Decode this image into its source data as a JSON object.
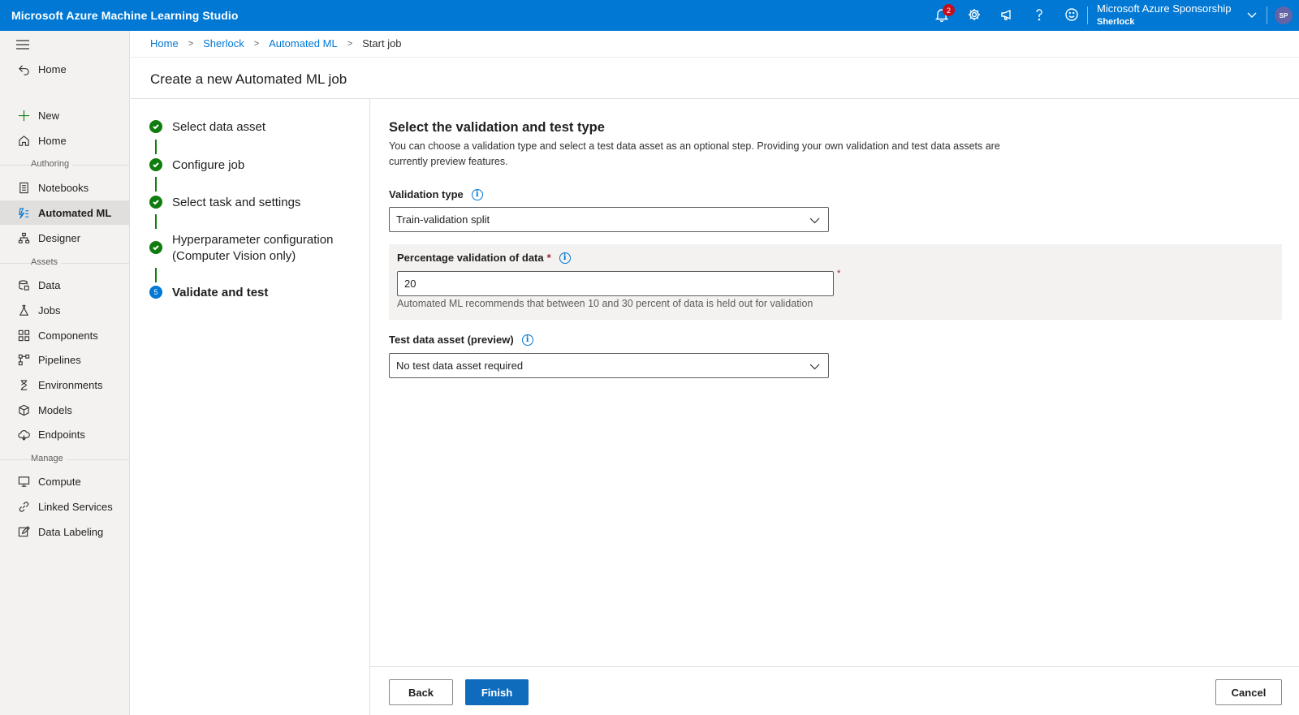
{
  "app": {
    "title": "Microsoft Azure Machine Learning Studio"
  },
  "topbar": {
    "notification_count": "2",
    "subscription": "Microsoft Azure Sponsorship",
    "workspace": "Sherlock",
    "avatar_initials": "SP",
    "icons": [
      "bell-icon",
      "gear-icon",
      "megaphone-icon",
      "help-icon",
      "smiley-icon",
      "chevron-down-icon"
    ]
  },
  "sidebar": {
    "top_item": {
      "label": "Home",
      "icon": "back-arrow-icon"
    },
    "sections": {
      "authoring": "Authoring",
      "assets": "Assets",
      "manage": "Manage"
    },
    "items": [
      {
        "label": "New",
        "icon": "plus-icon"
      },
      {
        "label": "Home",
        "icon": "home-icon"
      },
      {
        "label": "Notebooks",
        "icon": "notebook-icon"
      },
      {
        "label": "Automated ML",
        "icon": "automl-icon",
        "active": true
      },
      {
        "label": "Designer",
        "icon": "designer-icon"
      },
      {
        "label": "Data",
        "icon": "data-icon"
      },
      {
        "label": "Jobs",
        "icon": "flask-icon"
      },
      {
        "label": "Components",
        "icon": "components-icon"
      },
      {
        "label": "Pipelines",
        "icon": "pipelines-icon"
      },
      {
        "label": "Environments",
        "icon": "environments-icon"
      },
      {
        "label": "Models",
        "icon": "cube-icon"
      },
      {
        "label": "Endpoints",
        "icon": "cloud-icon"
      },
      {
        "label": "Compute",
        "icon": "monitor-icon"
      },
      {
        "label": "Linked Services",
        "icon": "link-icon"
      },
      {
        "label": "Data Labeling",
        "icon": "edit-icon"
      }
    ]
  },
  "breadcrumb": [
    "Home",
    "Sherlock",
    "Automated ML",
    "Start job"
  ],
  "page": {
    "title": "Create a new Automated ML job"
  },
  "steps": [
    {
      "label": "Select data asset",
      "status": "done"
    },
    {
      "label": "Configure job",
      "status": "done"
    },
    {
      "label": "Select task and settings",
      "status": "done"
    },
    {
      "label": "Hyperparameter configuration (Computer Vision only)",
      "status": "done"
    },
    {
      "label": "Validate and test",
      "status": "current",
      "number": "5"
    }
  ],
  "form": {
    "title": "Select the validation and test type",
    "description": "You can choose a validation type and select a test data asset as an optional step. Providing your own validation and test data assets are currently preview features.",
    "validation_type": {
      "label": "Validation type",
      "value": "Train-validation split"
    },
    "percentage": {
      "label": "Percentage validation of data",
      "required_mark": "*",
      "value": "20",
      "helper": "Automated ML recommends that between 10 and 30 percent of data is held out for validation"
    },
    "test_data": {
      "label": "Test data asset (preview)",
      "value": "No test data asset required"
    }
  },
  "footer": {
    "back": "Back",
    "finish": "Finish",
    "cancel": "Cancel"
  },
  "colors": {
    "brand": "#0078d4",
    "success": "#107c10",
    "primary_button": "#0f6cbd",
    "required": "#a4262c"
  }
}
